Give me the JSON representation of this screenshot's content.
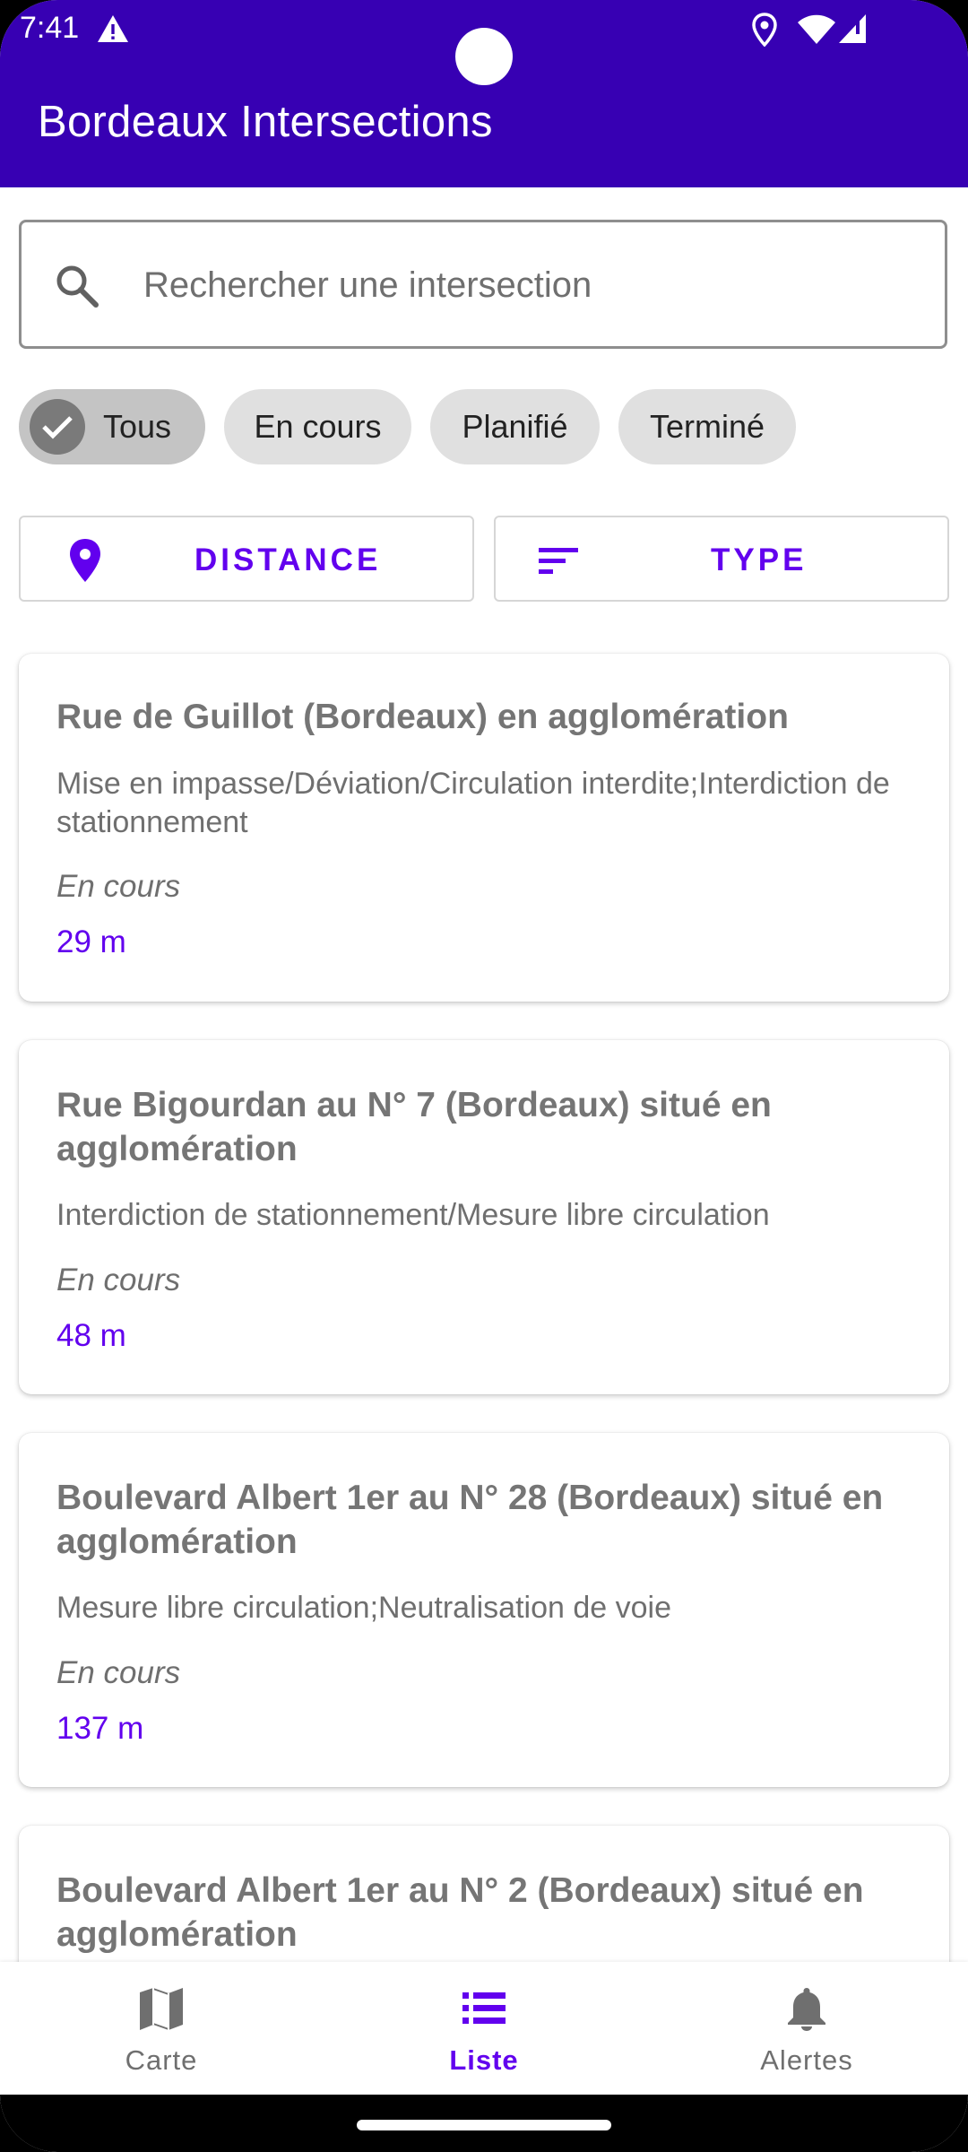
{
  "status_bar": {
    "time": "7:41"
  },
  "app_bar": {
    "title": "Bordeaux Intersections"
  },
  "search": {
    "placeholder": "Rechercher une intersection"
  },
  "chips": [
    {
      "label": "Tous",
      "selected": true
    },
    {
      "label": "En cours",
      "selected": false
    },
    {
      "label": "Planifié",
      "selected": false
    },
    {
      "label": "Terminé",
      "selected": false
    }
  ],
  "sort_buttons": {
    "distance_label": "DISTANCE",
    "type_label": "TYPE"
  },
  "colors": {
    "app_bar": "#3700B3",
    "accent": "#6200EE"
  },
  "intersections": [
    {
      "title": "Rue de Guillot (Bordeaux) en agglomération",
      "description": "Mise en impasse/Déviation/Circulation interdite;Interdiction de stationnement",
      "status": "En cours",
      "distance": "29 m"
    },
    {
      "title": "Rue Bigourdan au N° 7 (Bordeaux) situé en agglomération",
      "description": "Interdiction de stationnement/Mesure libre circulation",
      "status": "En cours",
      "distance": "48 m"
    },
    {
      "title": "Boulevard Albert 1er au N° 28 (Bordeaux) situé en agglomération",
      "description": "Mesure libre circulation;Neutralisation de voie",
      "status": "En cours",
      "distance": "137 m"
    },
    {
      "title": "Boulevard Albert 1er au N° 2 (Bordeaux) situé en agglomération"
    }
  ],
  "bottom_nav": [
    {
      "label": "Carte",
      "icon": "map-icon",
      "active": false
    },
    {
      "label": "Liste",
      "icon": "list-icon",
      "active": true
    },
    {
      "label": "Alertes",
      "icon": "bell-icon",
      "active": false
    }
  ]
}
